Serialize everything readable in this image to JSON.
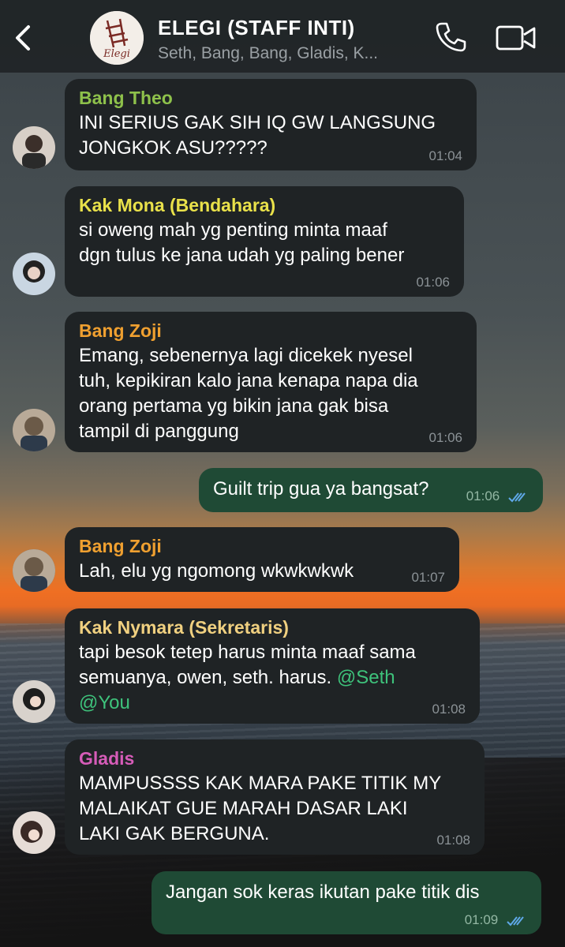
{
  "header": {
    "title": "ELEGI (STAFF INTI)",
    "members": "Seth, Bang, Bang, Gladis, K...",
    "logo_text": "Elegi"
  },
  "colors": {
    "outgoing_bubble": "#1f4a35",
    "incoming_bubble": "#1f2325",
    "mention": "#3ec27b",
    "read_ticks": "#5fa8e8"
  },
  "messages": [
    {
      "sender": "Bang Theo",
      "sender_color": "#8ec14b",
      "text": "INI SERIUS GAK SIH IQ GW LANGSUNG\nJONGKOK ASU?????",
      "time": "01:04"
    },
    {
      "sender": "Kak Mona (Bendahara)",
      "sender_color": "#e9e14a",
      "text": "si oweng mah yg penting minta maaf\ndgn tulus ke jana udah yg paling bener",
      "time": "01:06"
    },
    {
      "sender": "Bang Zoji",
      "sender_color": "#f0a030",
      "text": "Emang, sebenernya lagi dicekek nyesel\ntuh, kepikiran kalo jana kenapa napa dia\norang pertama yg bikin jana gak bisa\ntampil di panggung",
      "time": "01:06"
    },
    {
      "text": "Guilt trip gua ya bangsat?",
      "time": "01:06"
    },
    {
      "sender": "Bang Zoji",
      "sender_color": "#f0a030",
      "text": "Lah, elu yg ngomong wkwkwkwk",
      "time": "01:07"
    },
    {
      "sender": "Kak Nymara (Sekretaris)",
      "sender_color": "#f0d080",
      "text": "tapi besok tetep harus minta maaf sama\nsemuanya, owen, seth. harus.",
      "mention1": "@Seth",
      "mention2": "@You",
      "time": "01:08"
    },
    {
      "sender": "Gladis",
      "sender_color": "#d65cb8",
      "text": "MAMPUSSSS KAK MARA PAKE TITIK MY\nMALAIKAT GUE MARAH DASAR LAKI\nLAKI GAK BERGUNA.",
      "time": "01:08"
    },
    {
      "text": "Jangan sok keras ikutan pake titik dis",
      "time": "01:09"
    }
  ]
}
